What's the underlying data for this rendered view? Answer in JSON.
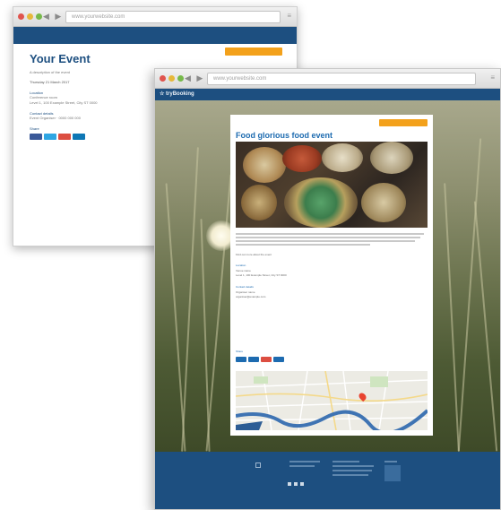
{
  "back_window": {
    "url": "www.yourwebsite.com",
    "event_title": "Your Event",
    "register_button": "",
    "when": "Thursday 21 March 2017",
    "host": "A description of the event",
    "location_label": "Location",
    "location_lines": [
      "Conference room",
      "Level 1, 100 Example Street, City ST 0000"
    ],
    "contact_label": "Contact details",
    "contact": "Event Organiser · 0000 000 000",
    "share_label": "Share"
  },
  "front_window": {
    "url": "www.yourwebsite.com",
    "brand": "tryBooking",
    "register_button": "",
    "event_title": "Food glorious food event",
    "summary_line": "Find out more about the event",
    "location_label": "Location",
    "location_lines": [
      "Venue name",
      "Level 1, 100 Example Street, City ST 0000"
    ],
    "contact_label": "Contact details",
    "contact_lines": [
      "Organiser name",
      "organiser@example.com"
    ],
    "share_label": "Share"
  },
  "colors": {
    "brand_blue": "#1d4f80",
    "link_blue": "#1d6bb0",
    "accent_orange": "#f3a11b"
  }
}
